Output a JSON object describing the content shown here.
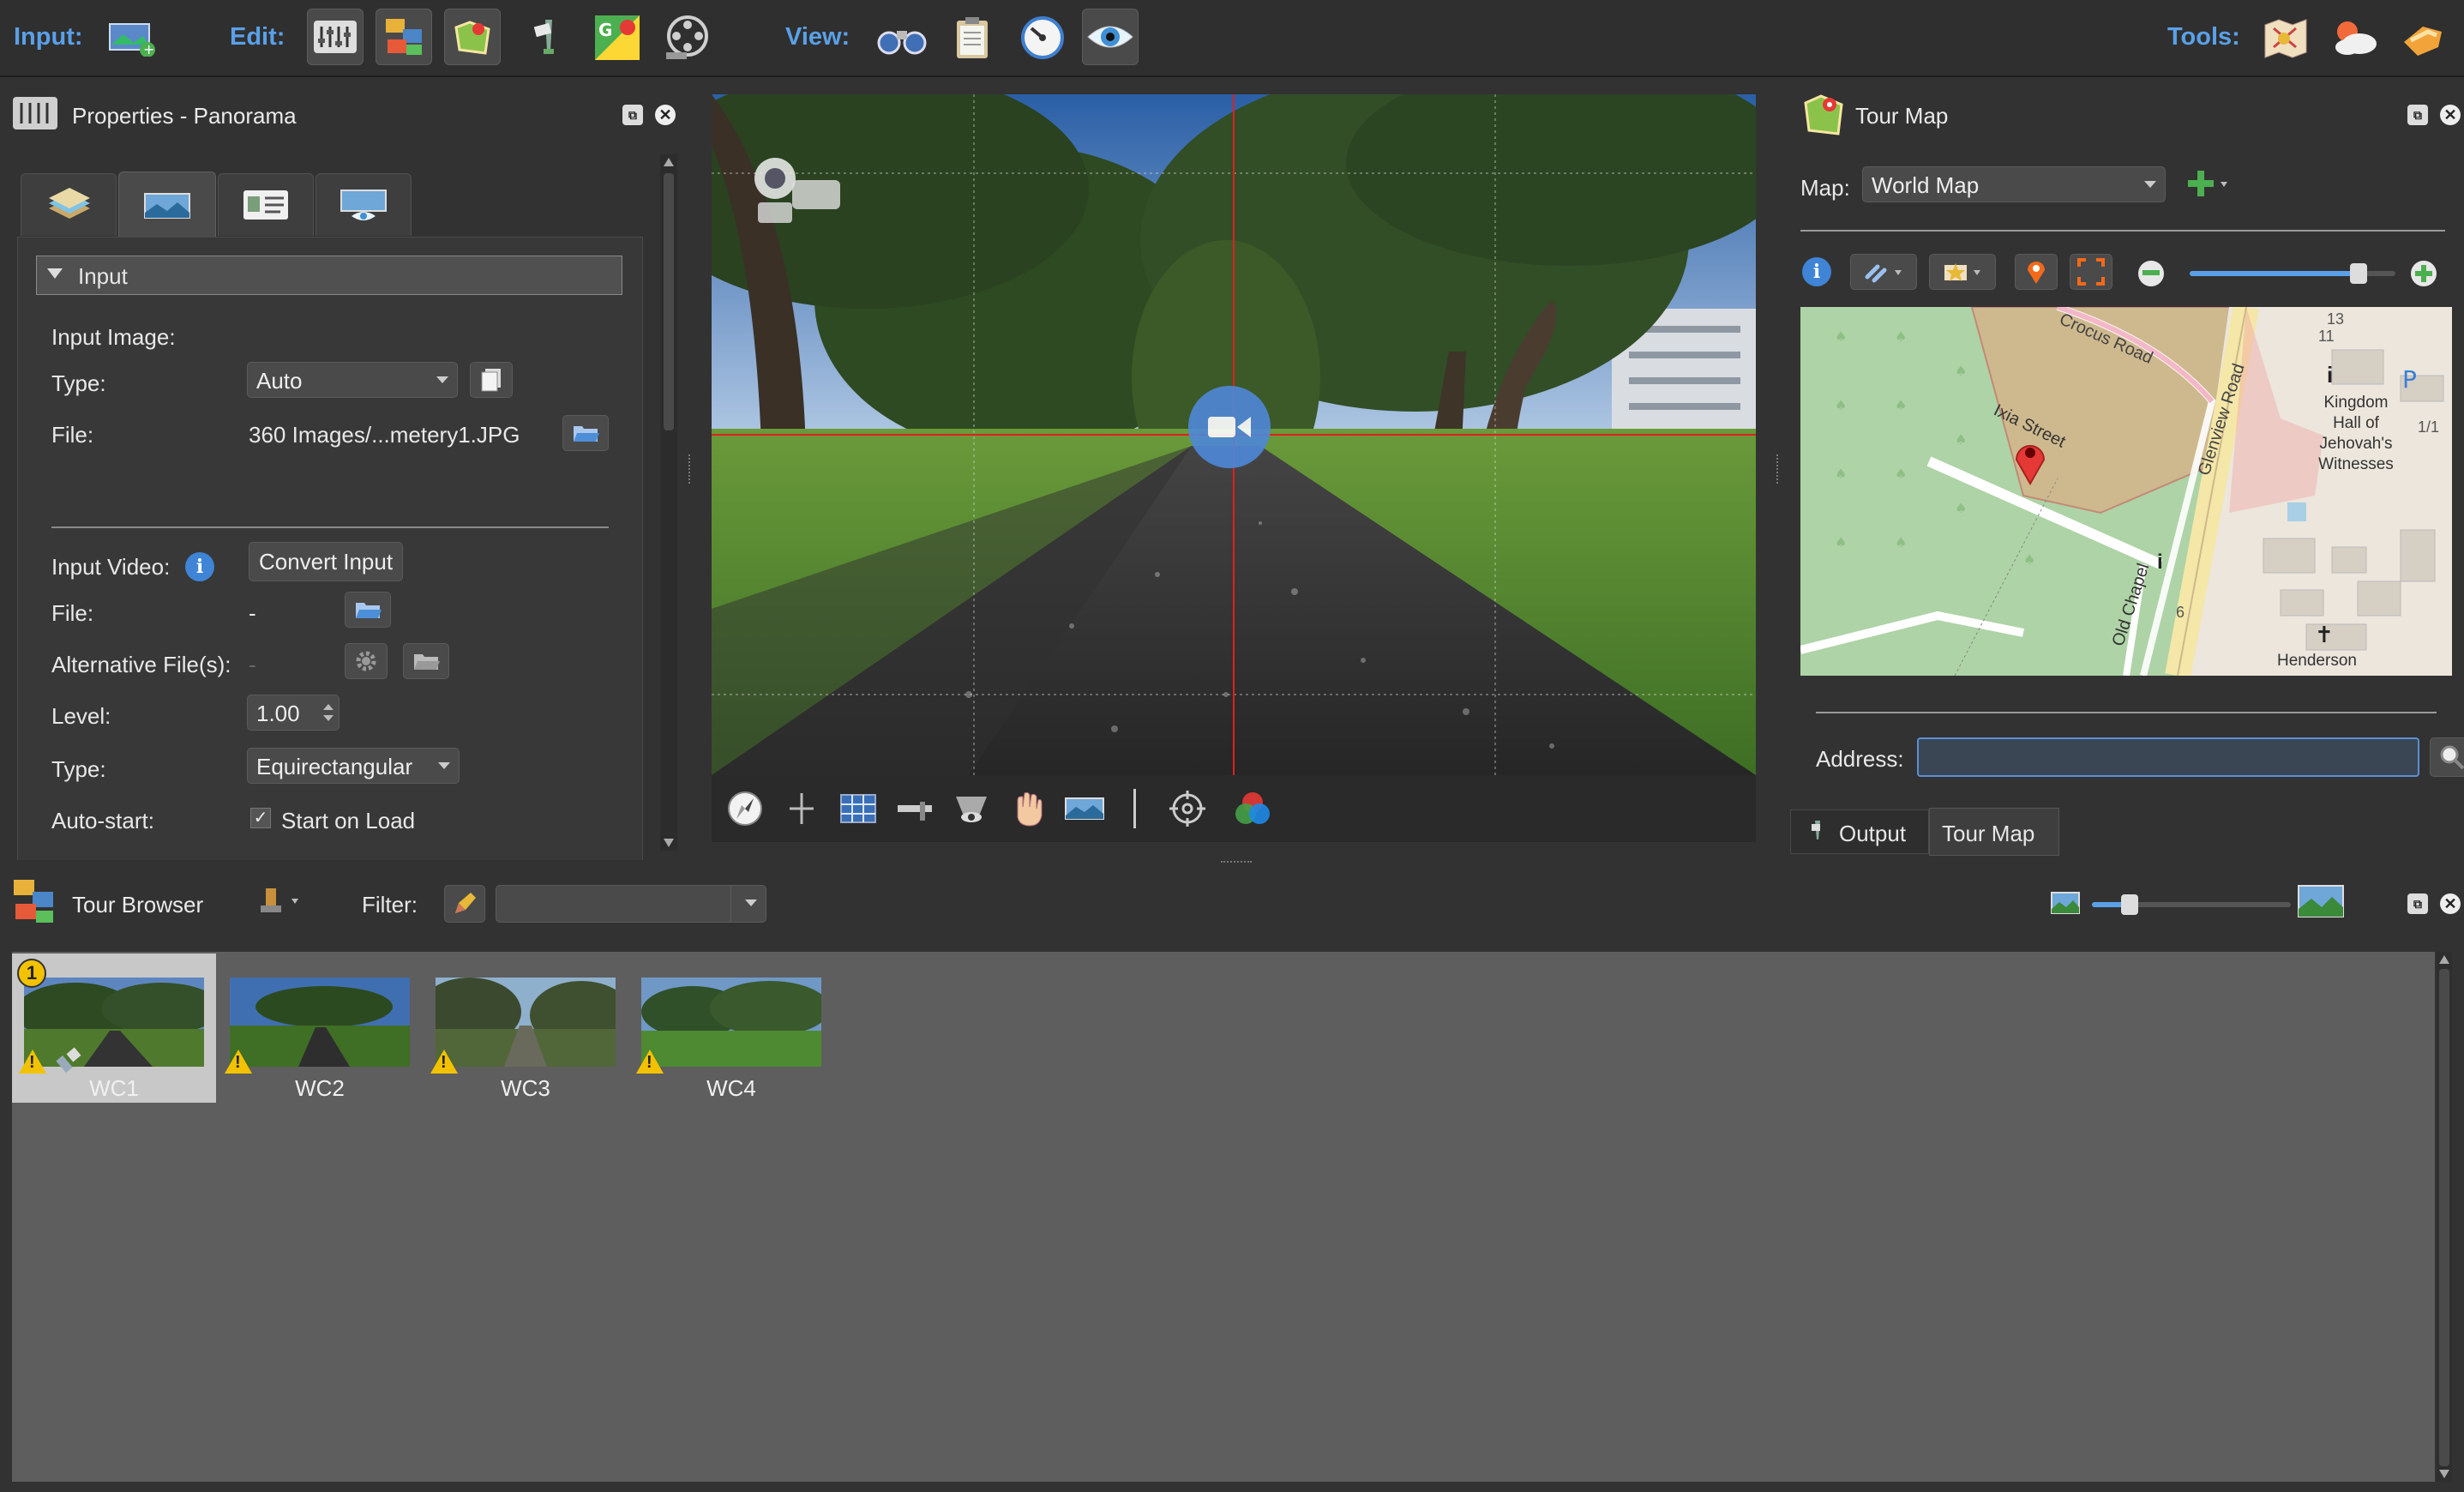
{
  "toolbar": {
    "input_label": "Input:",
    "edit_label": "Edit:",
    "view_label": "View:",
    "tools_label": "Tools:",
    "icons": [
      "add-panorama-icon",
      "properties-sliders-icon",
      "tour-browser-icon",
      "tour-map-icon",
      "pointer-icon",
      "google-maps-icon",
      "film-reel-icon",
      "binoculars-icon",
      "clipboard-icon",
      "gauge-icon",
      "eye-icon",
      "tools-map-icon",
      "weather-icon",
      "hand-icon"
    ]
  },
  "properties": {
    "title": "Properties - Panorama",
    "section": "Input",
    "input_image": "Input Image:",
    "type_label": "Type:",
    "type_value": "Auto",
    "file_label": "File:",
    "file_value": "360 Images/...metery1.JPG",
    "convert_button": "Convert Input",
    "input_video": "Input Video:",
    "video_file_label": "File:",
    "video_file_value": "-",
    "alt_files_label": "Alternative File(s):",
    "alt_files_value": "-",
    "level_label": "Level:",
    "level_value": "1.00",
    "video_type_label": "Type:",
    "video_type_value": "Equirectangular",
    "autostart_label": "Auto-start:",
    "autostart_check": "Start on Load"
  },
  "tour_map": {
    "title": "Tour Map",
    "map_label": "Map:",
    "map_value": "World Map",
    "zoom_fraction": 0.82,
    "streets": [
      "Crocus Road",
      "Ixia Street",
      "Glenview Road",
      "Old Chapel"
    ],
    "places": [
      "Kingdom Hall of Jehovah's Witnesses",
      "Henderson"
    ],
    "house_numbers": [
      "13",
      "11",
      "1/1",
      "6"
    ],
    "address_label": "Address:",
    "address_value": "",
    "tabs": [
      "Output",
      "Tour Map"
    ]
  },
  "tour_browser": {
    "title": "Tour Browser",
    "filter_label": "Filter:",
    "filter_value": "",
    "badge": "1",
    "items": [
      {
        "label": "WC1",
        "selected": true
      },
      {
        "label": "WC2",
        "selected": false
      },
      {
        "label": "WC3",
        "selected": false
      },
      {
        "label": "WC4",
        "selected": false
      }
    ]
  },
  "colors": {
    "accent_blue": "#5aa0e8",
    "warning": "#f2c200",
    "map_pin": "#e53935",
    "crosshair": "#e02020"
  }
}
